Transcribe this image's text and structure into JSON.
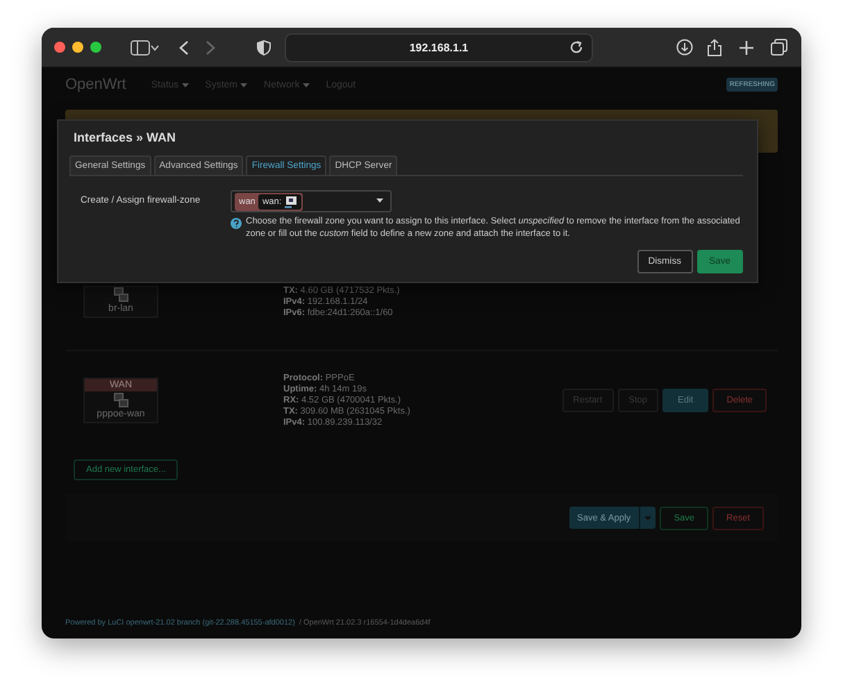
{
  "browser": {
    "address": "192.168.1.1"
  },
  "nav": {
    "brand": "OpenWrt",
    "menus": [
      "Status",
      "System",
      "Network"
    ],
    "logout": "Logout",
    "badge": "REFRESHING"
  },
  "interfaces": [
    {
      "device": "br-lan",
      "details": [
        {
          "label": "TX:",
          "value": "4.60 GB (4717532 Pkts.)"
        },
        {
          "label": "IPv4:",
          "value": "192.168.1.1/24"
        },
        {
          "label": "IPv6:",
          "value": "fdbe:24d1:260a::1/60"
        }
      ]
    },
    {
      "name": "WAN",
      "device": "pppoe-wan",
      "color": "#3a2020",
      "details": [
        {
          "label": "Protocol:",
          "value": "PPPoE"
        },
        {
          "label": "Uptime:",
          "value": "4h 14m 19s"
        },
        {
          "label": "RX:",
          "value": "4.52 GB (4700041 Pkts.)"
        },
        {
          "label": "TX:",
          "value": "309.60 MB (2631045 Pkts.)"
        },
        {
          "label": "IPv4:",
          "value": "100.89.239.113/32"
        }
      ],
      "buttons": [
        {
          "label": "Restart",
          "kind": "neutral"
        },
        {
          "label": "Stop",
          "kind": "neutral"
        },
        {
          "label": "Edit",
          "kind": "primary"
        },
        {
          "label": "Delete",
          "kind": "danger"
        }
      ]
    }
  ],
  "add_button": "Add new interface...",
  "actions": {
    "apply": "Save & Apply",
    "save": "Save",
    "reset": "Reset"
  },
  "footer": {
    "powered": "Powered by LuCI openwrt-21.02 branch (git-22.288.45155-afd0012)",
    "version": "/ OpenWrt 21.02.3 r16554-1d4dea6d4f"
  },
  "modal": {
    "title": "Interfaces » WAN",
    "tabs": [
      {
        "label": "General Settings",
        "selected": false
      },
      {
        "label": "Advanced Settings",
        "selected": false
      },
      {
        "label": "Firewall Settings",
        "selected": true
      },
      {
        "label": "DHCP Server",
        "selected": false
      }
    ],
    "field_label": "Create / Assign firewall-zone",
    "zone": {
      "name": "wan",
      "networks": "wan:",
      "color": "#7a4545"
    },
    "help": "Choose the firewall zone you want to assign to this interface. Select *unspecified* to remove the interface from the associated zone or fill out the *custom* field to define a new zone and attach the interface to it.",
    "buttons": [
      {
        "label": "Dismiss",
        "kind": "neutral"
      },
      {
        "label": "Save",
        "kind": "positive"
      }
    ]
  }
}
